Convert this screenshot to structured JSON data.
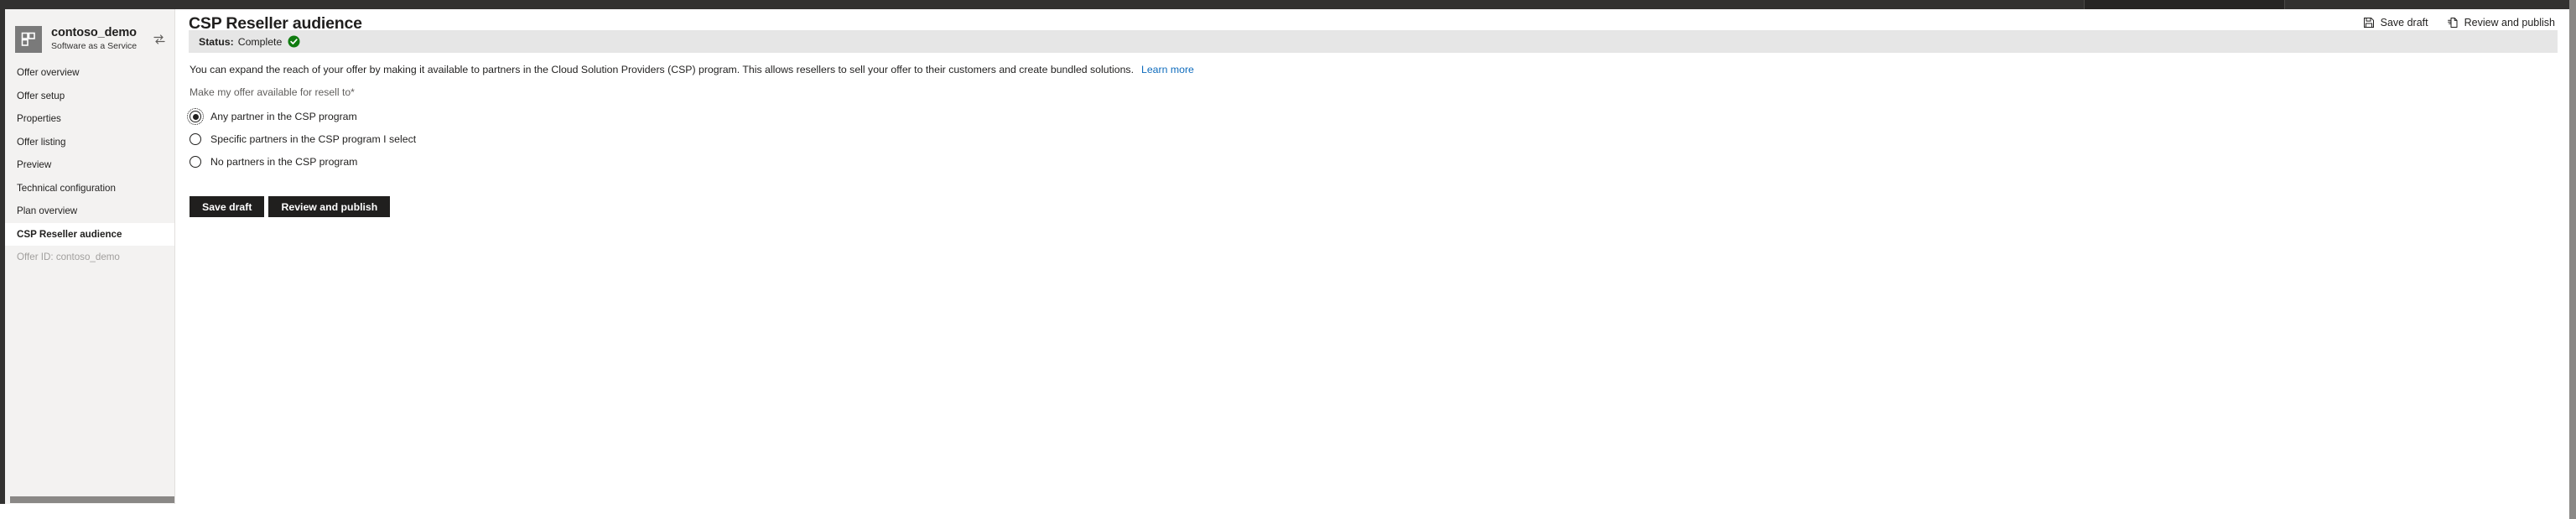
{
  "browser": {
    "tab_strip_color": "#323130",
    "active_tab_color": "#262524"
  },
  "sidebar": {
    "offer": {
      "tile_icon": "app-tile-icon",
      "name": "contoso_demo",
      "kind": "Software as a Service",
      "swap_icon": "swap-offers-icon"
    },
    "items": [
      {
        "label": "Offer overview",
        "selected": false,
        "muted": false
      },
      {
        "label": "Offer setup",
        "selected": false,
        "muted": false
      },
      {
        "label": "Properties",
        "selected": false,
        "muted": false
      },
      {
        "label": "Offer listing",
        "selected": false,
        "muted": false
      },
      {
        "label": "Preview",
        "selected": false,
        "muted": false
      },
      {
        "label": "Technical configuration",
        "selected": false,
        "muted": false
      },
      {
        "label": "Plan overview",
        "selected": false,
        "muted": false
      },
      {
        "label": "CSP Reseller audience",
        "selected": true,
        "muted": false
      },
      {
        "label": "Offer ID: contoso_demo",
        "selected": false,
        "muted": true
      }
    ]
  },
  "main": {
    "page_title": "CSP Reseller audience",
    "top_actions": [
      {
        "label": "Save draft",
        "icon": "save-floppy-icon"
      },
      {
        "label": "Review and publish",
        "icon": "publish-document-icon"
      }
    ],
    "status": {
      "label": "Status:",
      "value": "Complete",
      "icon": "green-check-circle-icon",
      "color": "#107c10"
    },
    "description": "You can expand the reach of your offer by making it available to partners in the Cloud Solution Providers (CSP) program. This allows resellers to sell your offer to their customers and create bundled solutions.",
    "learn_more": "Learn more",
    "field_label": "Make my offer available for resell to",
    "required_marker": "*",
    "radio_options": [
      {
        "label": "Any partner in the CSP program",
        "checked": true,
        "focused": true
      },
      {
        "label": "Specific partners in the CSP program I select",
        "checked": false,
        "focused": false
      },
      {
        "label": "No partners in the CSP program",
        "checked": false,
        "focused": false
      }
    ],
    "bottom_actions": [
      {
        "label": "Save draft"
      },
      {
        "label": "Review and publish"
      }
    ]
  }
}
